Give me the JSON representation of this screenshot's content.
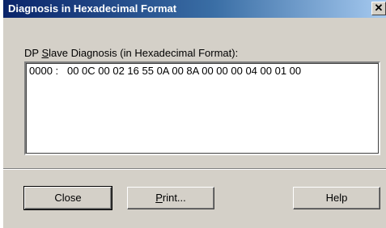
{
  "window": {
    "title": "Diagnosis in Hexadecimal Format",
    "close_glyph": "✕"
  },
  "content": {
    "label_pre": "DP ",
    "label_accel": "S",
    "label_post": "lave Diagnosis (in Hexadecimal Format):",
    "hex_lines": [
      "0000 :   00 0C 00 02 16 55 0A 00 8A 00 00 00 04 00 01 00"
    ]
  },
  "buttons": {
    "close_label": "Close",
    "print_accel": "P",
    "print_rest": "rint...",
    "help_label": "Help"
  }
}
